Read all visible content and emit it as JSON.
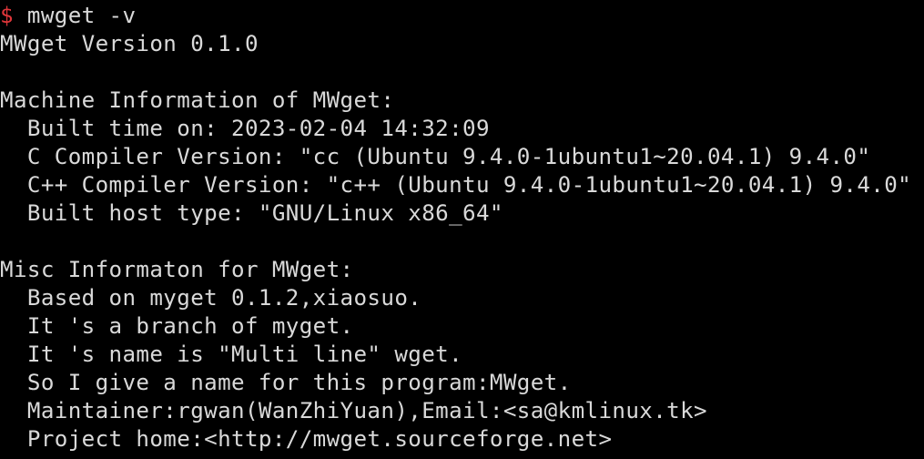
{
  "terminal": {
    "prompt_symbol": "$",
    "command": " mwget -v",
    "output": [
      "MWget Version 0.1.0",
      "",
      "Machine Information of MWget:",
      "  Built time on: 2023-02-04 14:32:09",
      "  C Compiler Version: \"cc (Ubuntu 9.4.0-1ubuntu1~20.04.1) 9.4.0\"",
      "  C++ Compiler Version: \"c++ (Ubuntu 9.4.0-1ubuntu1~20.04.1) 9.4.0\"",
      "  Built host type: \"GNU/Linux x86_64\"",
      "",
      "Misc Informaton for MWget:",
      "  Based on myget 0.1.2,xiaosuo.",
      "  It 's a branch of myget.",
      "  It 's name is \"Multi line\" wget.",
      "  So I give a name for this program:MWget.",
      "  Maintainer:rgwan(WanZhiYuan),Email:<sa@kmlinux.tk>",
      "  Project home:<http://mwget.sourceforge.net>"
    ]
  },
  "colors": {
    "background": "#000000",
    "text": "#d9d9d9",
    "prompt": "#e0363a"
  }
}
